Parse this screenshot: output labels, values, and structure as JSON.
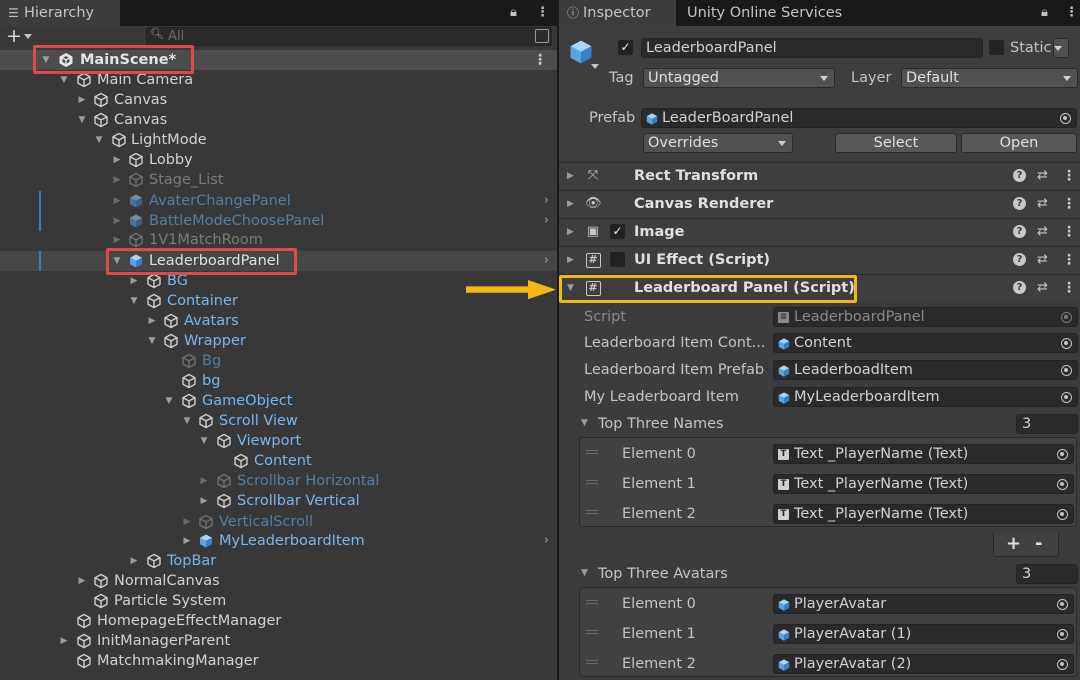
{
  "hierarchy": {
    "tab_label": "Hierarchy",
    "search_placeholder": "All",
    "add_label": "+",
    "rows": [
      {
        "label": "MainScene*"
      },
      {
        "label": "Main Camera"
      },
      {
        "label": "Canvas"
      },
      {
        "label": "Canvas"
      },
      {
        "label": "LightMode"
      },
      {
        "label": "Lobby"
      },
      {
        "label": "Stage_List"
      },
      {
        "label": "AvaterChangePanel"
      },
      {
        "label": "BattleModeChoosePanel"
      },
      {
        "label": "1V1MatchRoom"
      },
      {
        "label": "LeaderboardPanel"
      },
      {
        "label": "BG"
      },
      {
        "label": "Container"
      },
      {
        "label": "Avatars"
      },
      {
        "label": "Wrapper"
      },
      {
        "label": "Bg"
      },
      {
        "label": "bg"
      },
      {
        "label": "GameObject"
      },
      {
        "label": "Scroll View"
      },
      {
        "label": "Viewport"
      },
      {
        "label": "Content"
      },
      {
        "label": "Scrollbar Horizontal"
      },
      {
        "label": "Scrollbar Vertical"
      },
      {
        "label": "VerticalScroll"
      },
      {
        "label": "MyLeaderboardItem"
      },
      {
        "label": "TopBar"
      },
      {
        "label": "NormalCanvas"
      },
      {
        "label": "Particle System"
      },
      {
        "label": "HomepageEffectManager"
      },
      {
        "label": "InitManagerParent"
      },
      {
        "label": "MatchmakingManager"
      }
    ]
  },
  "inspector": {
    "tab_inspector": "Inspector",
    "tab_services": "Unity Online Services",
    "object_name": "LeaderboardPanel",
    "static_label": "Static",
    "tag_label": "Tag",
    "tag_value": "Untagged",
    "layer_label": "Layer",
    "layer_value": "Default",
    "prefab_label": "Prefab",
    "prefab_value": "LeaderBoardPanel",
    "overrides_label": "Overrides",
    "select_label": "Select",
    "open_label": "Open",
    "components": [
      {
        "name": "Rect Transform"
      },
      {
        "name": "Canvas Renderer"
      },
      {
        "name": "Image"
      },
      {
        "name": "UI Effect (Script)"
      },
      {
        "name": "Leaderboard Panel (Script)"
      }
    ],
    "fields": {
      "script_label": "Script",
      "script_value": "LeaderboardPanel",
      "item_content_label": "Leaderboard Item Cont...",
      "item_content_value": "Content",
      "item_prefab_label": "Leaderboard Item Prefab",
      "item_prefab_value": "LeaderboadItem",
      "my_item_label": "My Leaderboard Item",
      "my_item_value": "MyLeaderboardItem"
    },
    "top_names": {
      "label": "Top Three Names",
      "size": "3",
      "elements": [
        {
          "label": "Element 0",
          "value": "Text _PlayerName (Text)"
        },
        {
          "label": "Element 1",
          "value": "Text _PlayerName (Text)"
        },
        {
          "label": "Element 2",
          "value": "Text _PlayerName (Text)"
        }
      ]
    },
    "list_plus": "+",
    "list_minus": "-",
    "top_avatars": {
      "label": "Top Three Avatars",
      "size": "3",
      "elements": [
        {
          "label": "Element 0",
          "value": "PlayerAvatar"
        },
        {
          "label": "Element 1",
          "value": "PlayerAvatar (1)"
        },
        {
          "label": "Element 2",
          "value": "PlayerAvatar (2)"
        }
      ]
    }
  },
  "colors": {
    "prefab_text": "#7ab6ec",
    "highlight_red": "#e0484f",
    "highlight_yellow": "#f4b816",
    "panel_bg": "#383838"
  }
}
